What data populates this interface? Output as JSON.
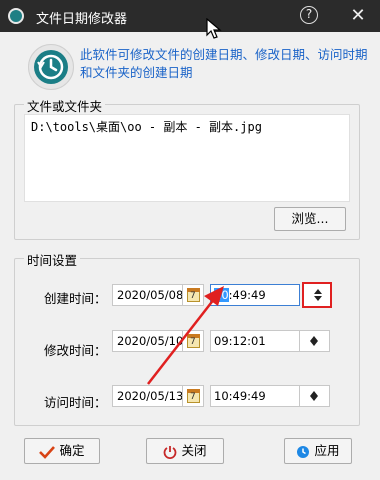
{
  "window": {
    "title": "文件日期修改器",
    "help_glyph": "?",
    "close_glyph": "✕"
  },
  "description": "此软件可修改文件的创建日期、修改日期、访问时期和文件夹的创建日期",
  "file_group": {
    "label": "文件或文件夹",
    "path": "D:\\tools\\桌面\\oo - 副本 - 副本.jpg",
    "browse_label": "浏览..."
  },
  "time_group": {
    "label": "时间设置",
    "rows": [
      {
        "label": "创建时间：",
        "date": "2020/05/08",
        "time_selected": "10",
        "time_rest": ":49:49"
      },
      {
        "label": "修改时间：",
        "date": "2020/05/10",
        "time_selected": "",
        "time_rest": "09:12:01"
      },
      {
        "label": "访问时间：",
        "date": "2020/05/13",
        "time_selected": "",
        "time_rest": "10:49:49"
      }
    ],
    "calendar_icon_text": "7"
  },
  "buttons": {
    "ok": "确定",
    "close": "关闭",
    "apply": "应用"
  },
  "icons": {
    "app": "clock-icon",
    "ok": "check-icon",
    "close": "power-icon",
    "apply": "clock-icon"
  },
  "colors": {
    "title_bar": "#2b2b2b",
    "description": "#1a63c8",
    "highlight": "#e02020",
    "selection": "#3399ff"
  }
}
